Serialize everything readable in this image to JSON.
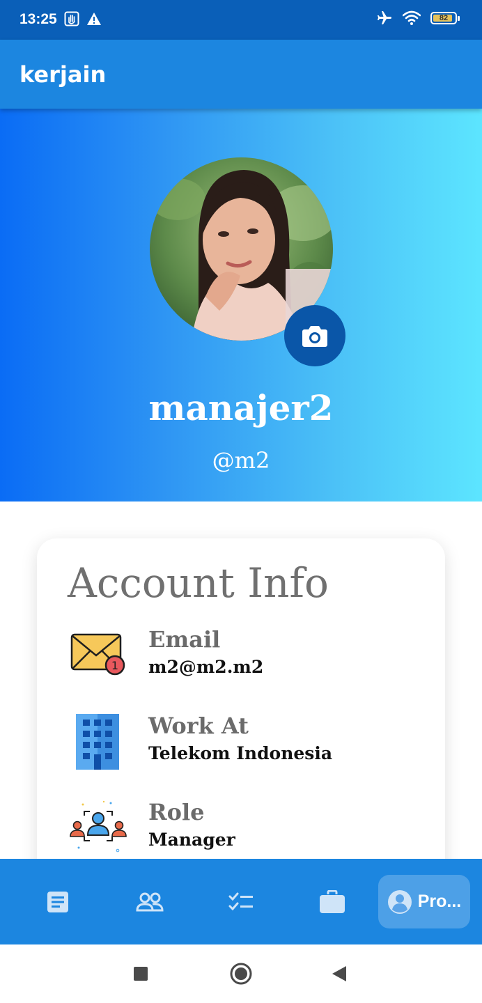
{
  "status_bar": {
    "time": "13:25",
    "battery_level": "82",
    "icons": [
      "hand-icon",
      "warning-icon",
      "airplane-icon",
      "wifi-icon",
      "battery-icon"
    ]
  },
  "app_bar": {
    "title": "kerjain"
  },
  "profile": {
    "display_name": "manajer2",
    "username": "@m2",
    "avatar": "profile-photo",
    "camera_icon": "camera-icon"
  },
  "account_info": {
    "title": "Account Info",
    "rows": [
      {
        "icon": "envelope-icon",
        "badge": "1",
        "label": "Email",
        "value": "m2@m2.m2"
      },
      {
        "icon": "building-icon",
        "label": "Work At",
        "value": "Telekom Indonesia"
      },
      {
        "icon": "team-icon",
        "label": "Role",
        "value": "Manager"
      }
    ]
  },
  "bottom_nav": {
    "items": [
      {
        "icon": "document-icon",
        "label": ""
      },
      {
        "icon": "people-icon",
        "label": ""
      },
      {
        "icon": "checklist-icon",
        "label": ""
      },
      {
        "icon": "briefcase-icon",
        "label": ""
      },
      {
        "icon": "profile-icon",
        "label": "Pro...",
        "active": true
      }
    ]
  },
  "colors": {
    "status_bar": "#0a5fb8",
    "app_bar": "#1c86e0",
    "hero_gradient_start": "#0a6cf5",
    "hero_gradient_end": "#5ce5ff",
    "camera_button": "#0a56a8",
    "nav_icon": "#cfe4f8"
  }
}
